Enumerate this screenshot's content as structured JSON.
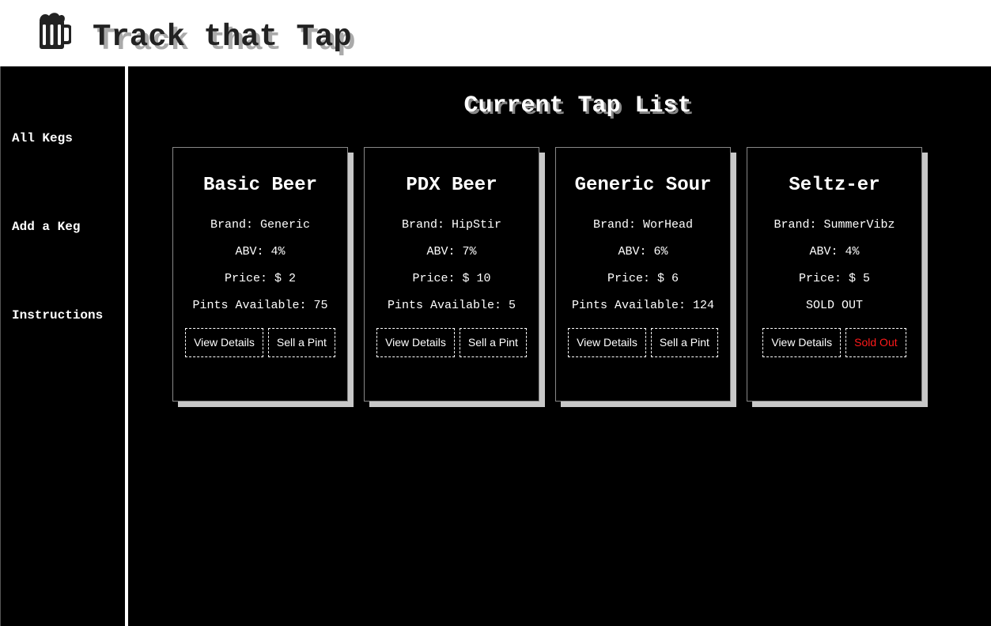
{
  "app": {
    "title": "Track that Tap"
  },
  "sidebar": {
    "items": [
      {
        "label": "All Kegs"
      },
      {
        "label": "Add a Keg"
      },
      {
        "label": "Instructions"
      }
    ]
  },
  "main": {
    "title": "Current Tap List"
  },
  "kegs": [
    {
      "name": "Basic Beer",
      "brand": "Brand: Generic",
      "abv": "ABV: 4%",
      "price": "Price: $ 2",
      "pints": "Pints Available: 75",
      "details_label": "View Details",
      "sell_label": "Sell a Pint"
    },
    {
      "name": "PDX Beer",
      "brand": "Brand: HipStir",
      "abv": "ABV: 7%",
      "price": "Price: $ 10",
      "pints": "Pints Available: 5",
      "details_label": "View Details",
      "sell_label": "Sell a Pint"
    },
    {
      "name": "Generic Sour",
      "brand": "Brand: WorHead",
      "abv": "ABV: 6%",
      "price": "Price: $ 6",
      "pints": "Pints Available: 124",
      "details_label": "View Details",
      "sell_label": "Sell a Pint"
    },
    {
      "name": "Seltz-er",
      "brand": "Brand: SummerVibz",
      "abv": "ABV: 4%",
      "price": "Price: $ 5",
      "pints": "SOLD OUT",
      "details_label": "View Details",
      "sell_label": "Sold Out"
    }
  ],
  "icons": {
    "logo": "beer-mug-icon"
  },
  "colors": {
    "background": "#000000",
    "text": "#ffffff",
    "sold_out": "#ff1a1a",
    "card_shadow": "#c8c8c8"
  }
}
